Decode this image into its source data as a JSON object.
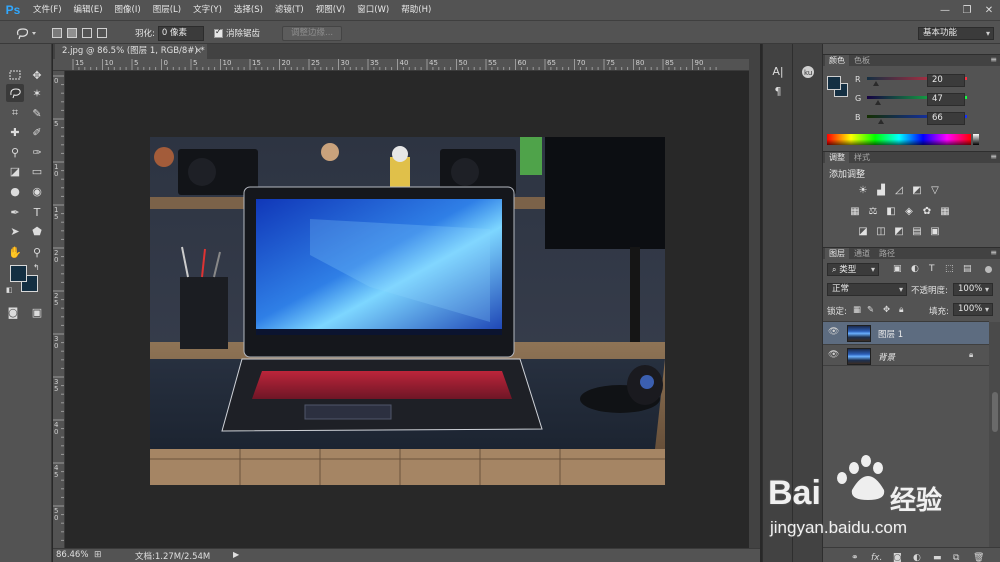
{
  "app": {
    "logo": "Ps"
  },
  "menu": [
    "文件(F)",
    "编辑(E)",
    "图像(I)",
    "图层(L)",
    "文字(Y)",
    "选择(S)",
    "滤镜(T)",
    "视图(V)",
    "窗口(W)",
    "帮助(H)"
  ],
  "window_controls": {
    "minimize": "—",
    "restore": "❐",
    "close": "✕"
  },
  "options": {
    "feather_label": "羽化:",
    "feather_value": "0 像素",
    "antialias_label": "消除锯齿",
    "refine_edge": "调整边缘...",
    "workspace": "基本功能"
  },
  "document": {
    "tab_title": "2.jpg @ 86.5% (图层 1, RGB/8#) *",
    "tab_close": "×"
  },
  "ruler_top": [
    "15",
    "10",
    "5",
    "0",
    "5",
    "10",
    "15",
    "20",
    "25",
    "30",
    "35",
    "40",
    "45",
    "50",
    "55",
    "60",
    "65",
    "70",
    "75",
    "80",
    "85",
    "90"
  ],
  "ruler_left": [
    "0",
    "5",
    "1\n0",
    "1\n5",
    "2\n0",
    "2\n5",
    "3\n0",
    "3\n5",
    "4\n0",
    "4\n5",
    "5\n0"
  ],
  "status": {
    "zoom": "86.46%",
    "doc_info": "文档:1.27M/2.54M"
  },
  "color_panel": {
    "tabs": [
      "颜色",
      "色板"
    ],
    "channels": [
      {
        "label": "R",
        "value": "20"
      },
      {
        "label": "G",
        "value": "47"
      },
      {
        "label": "B",
        "value": "66"
      }
    ],
    "foreground": "#142f42"
  },
  "adjustments_panel": {
    "tabs": [
      "调整",
      "样式"
    ],
    "title": "添加调整"
  },
  "layers_panel": {
    "tabs": [
      "图层",
      "通道",
      "路径"
    ],
    "filter": "类型",
    "blend_mode": "正常",
    "opacity_label": "不透明度:",
    "opacity_value": "100%",
    "lock_label": "锁定:",
    "fill_label": "填充:",
    "fill_value": "100%",
    "layers": [
      {
        "name": "图层 1",
        "selected": true
      },
      {
        "name": "背景",
        "selected": false,
        "locked": true
      }
    ]
  },
  "watermark": {
    "brand": "Bai",
    "brand_cn": "经验",
    "url": "jingyan.baidu.com"
  }
}
